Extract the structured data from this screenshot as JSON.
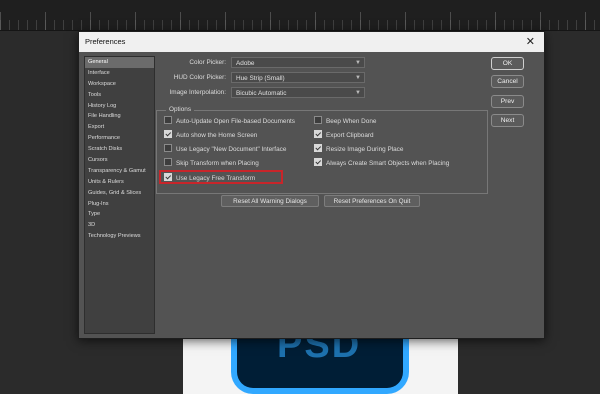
{
  "dialog": {
    "title": "Preferences",
    "close_glyph": "✕"
  },
  "sidebar": {
    "items": [
      {
        "label": "General",
        "active": true
      },
      {
        "label": "Interface"
      },
      {
        "label": "Workspace"
      },
      {
        "label": "Tools"
      },
      {
        "label": "History Log"
      },
      {
        "label": "File Handling"
      },
      {
        "label": "Export"
      },
      {
        "label": "Performance"
      },
      {
        "label": "Scratch Disks"
      },
      {
        "label": "Cursors"
      },
      {
        "label": "Transparency & Gamut"
      },
      {
        "label": "Units & Rulers"
      },
      {
        "label": "Guides, Grid & Slices"
      },
      {
        "label": "Plug-Ins"
      },
      {
        "label": "Type"
      },
      {
        "label": "3D"
      },
      {
        "label": "Technology Previews"
      }
    ]
  },
  "fields": {
    "color_picker": {
      "label": "Color Picker:",
      "value": "Adobe"
    },
    "hud_color_picker": {
      "label": "HUD Color Picker:",
      "value": "Hue Strip (Small)"
    },
    "image_interpolation": {
      "label": "Image Interpolation:",
      "value": "Bicubic Automatic"
    }
  },
  "options": {
    "legend": "Options",
    "left": [
      {
        "label": "Auto-Update Open File-based Documents",
        "checked": false
      },
      {
        "label": "Auto show the Home Screen",
        "checked": true
      },
      {
        "label": "Use Legacy \"New Document\" Interface",
        "checked": false
      },
      {
        "label": "Skip Transform when Placing",
        "checked": false
      },
      {
        "label": "Use Legacy Free Transform",
        "checked": true
      }
    ],
    "right": [
      {
        "label": "Beep When Done",
        "checked": false
      },
      {
        "label": "Export Clipboard",
        "checked": true
      },
      {
        "label": "Resize Image During Place",
        "checked": true
      },
      {
        "label": "Always Create Smart Objects when Placing",
        "checked": true
      }
    ]
  },
  "buttons": {
    "reset_warnings": "Reset All Warning Dialogs",
    "reset_prefs": "Reset Preferences On Quit",
    "ok": "OK",
    "cancel": "Cancel",
    "prev": "Prev",
    "next": "Next"
  },
  "colors": {
    "highlight": "#c8252a",
    "dialog_bg": "#535353",
    "psd_blue": "#31a8ff"
  },
  "background": {
    "logo_text": "PSD"
  }
}
